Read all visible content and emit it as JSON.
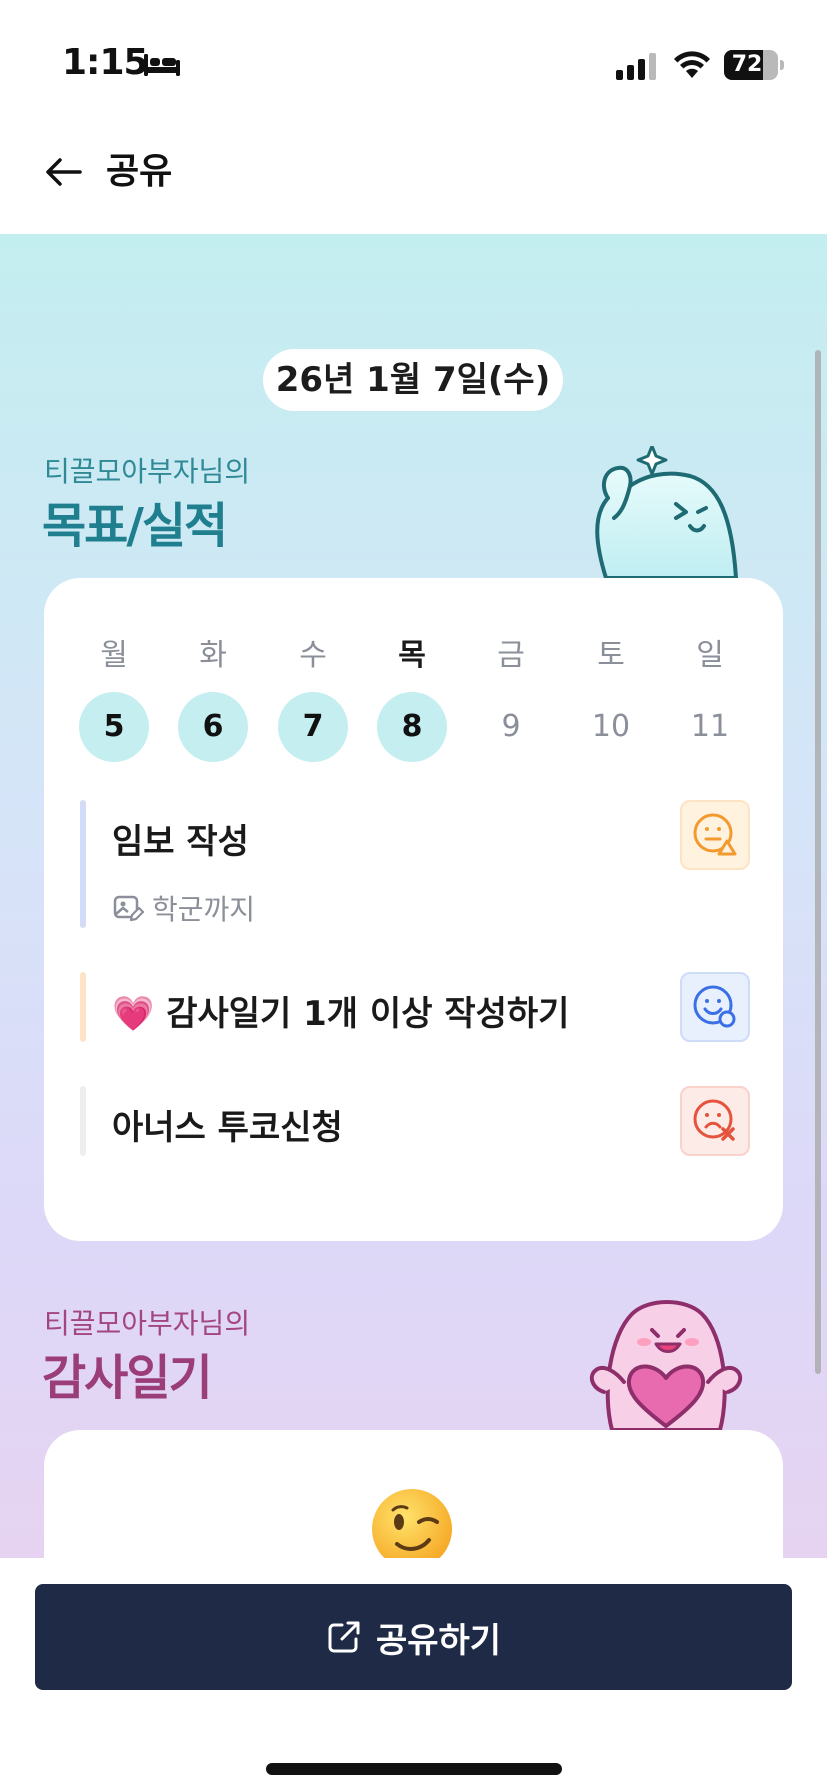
{
  "status": {
    "time": "1:15",
    "battery": "72",
    "battery_level": 0.72,
    "icons": [
      "bed-icon",
      "signal-icon",
      "wifi-icon",
      "battery-icon"
    ]
  },
  "nav": {
    "title": "공유",
    "back_icon": "arrow-left-icon"
  },
  "date_label": "26년 1월 7일(수)",
  "goals": {
    "owner_label": "티끌모아부자님의",
    "title": "목표/실적",
    "weekdays": [
      "월",
      "화",
      "수",
      "목",
      "금",
      "토",
      "일"
    ],
    "days": [
      "5",
      "6",
      "7",
      "8",
      "9",
      "10",
      "11"
    ],
    "tasks": [
      {
        "label": "임보 작성",
        "note": "학군까지",
        "note_icon": "image-edit-icon",
        "status_icon": "face-warning-icon"
      },
      {
        "emoji": "💗",
        "label": "감사일기 1개 이상 작성하기",
        "status_icon": "face-done-icon"
      },
      {
        "label": "아너스 투코신청",
        "status_icon": "face-fail-icon"
      }
    ]
  },
  "thanks": {
    "owner_label": "티끌모아부자님의",
    "title": "감사일기"
  },
  "share": {
    "label": "공유하기",
    "icon": "external-link-icon"
  },
  "colors": {
    "teal_title": "#1f7f8e",
    "pink_title": "#9a3d78",
    "share_button": "#1f2a47",
    "day_fill": "#c4eef0"
  }
}
